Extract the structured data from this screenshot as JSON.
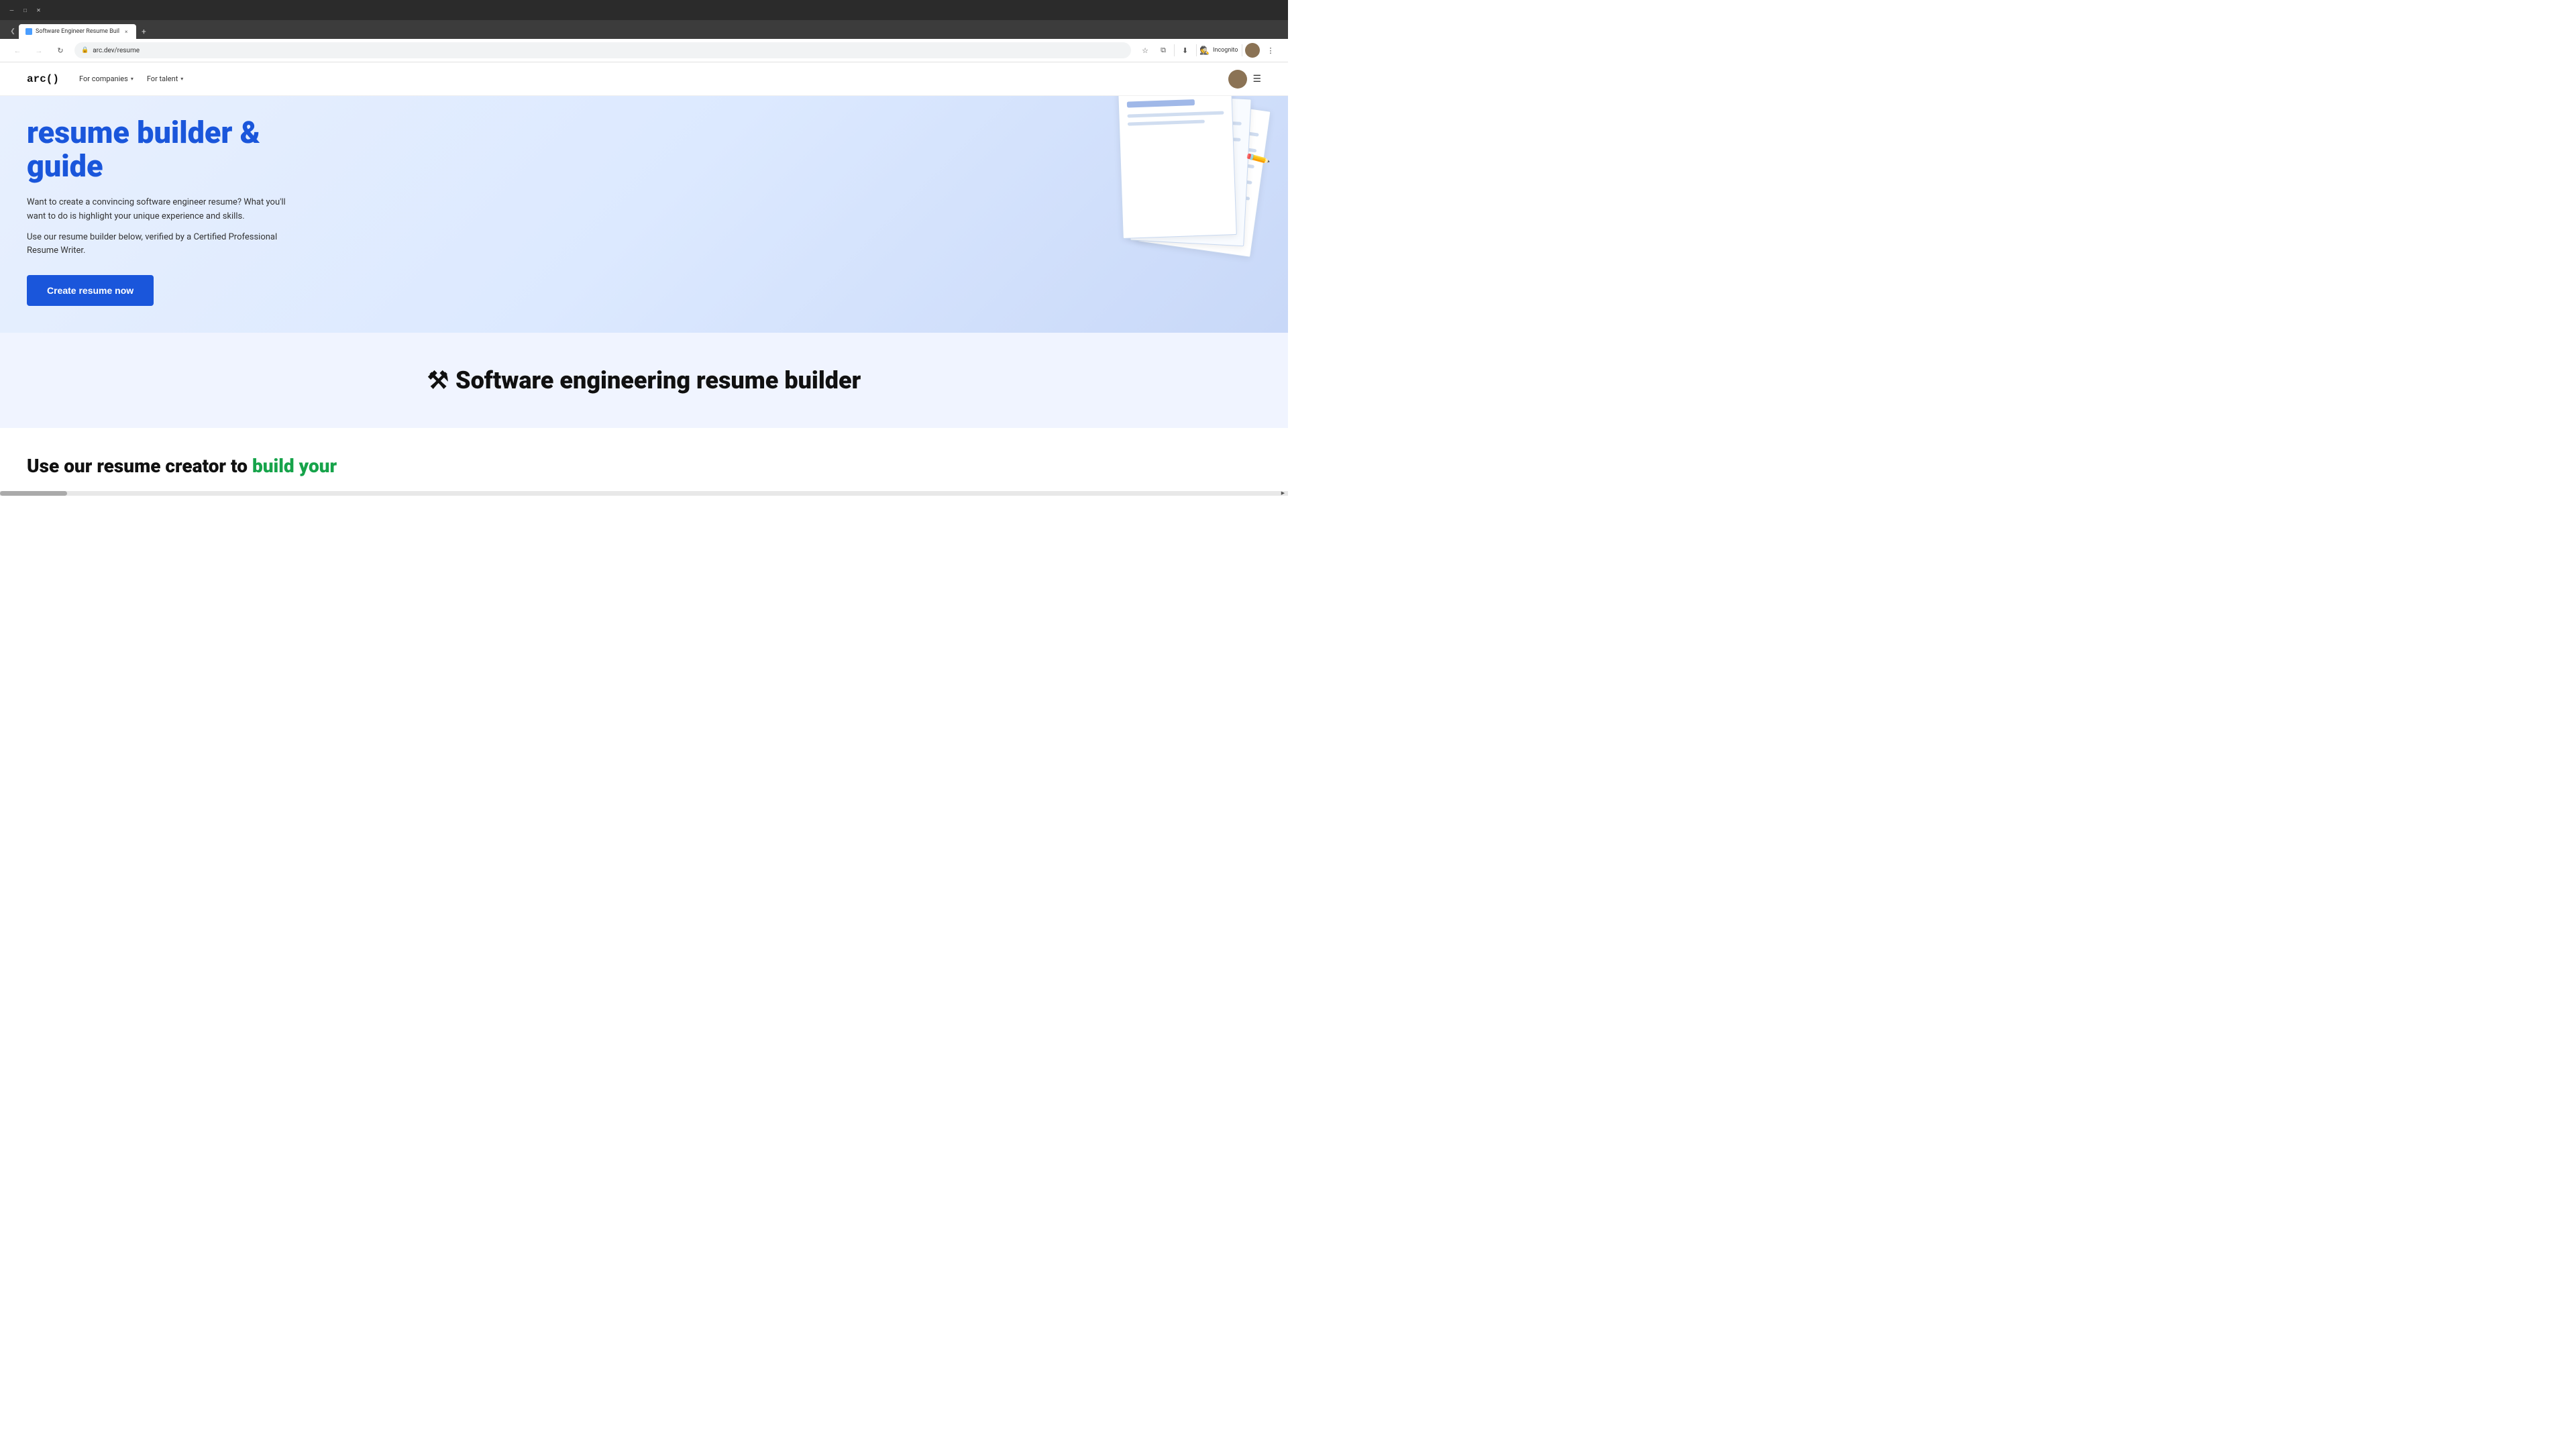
{
  "browser": {
    "tab": {
      "favicon_label": "arc",
      "title": "Software Engineer Resume Buil",
      "close_label": "×"
    },
    "new_tab_label": "+",
    "address": {
      "url": "arc.dev/resume",
      "back_icon": "←",
      "forward_icon": "→",
      "refresh_icon": "↻",
      "star_icon": "☆",
      "extensions_icon": "⧉",
      "download_icon": "⬇",
      "incognito_label": "Incognito",
      "menu_icon": "⋮"
    }
  },
  "site": {
    "logo": "arc()",
    "nav": {
      "companies_label": "For companies",
      "talent_label": "For talent",
      "chevron": "▾"
    },
    "hero": {
      "title": "resume builder & guide",
      "description1": "Want to create a convincing software engineer resume? What you'll want to do is highlight your unique experience and skills.",
      "description2": "Use our resume builder below, verified by a Certified Professional Resume Writer.",
      "cta_label": "Create resume now"
    },
    "section2": {
      "icon": "⚒",
      "title": "Software engineering resume builder"
    },
    "section3": {
      "text_part1": "Use our resume creator to",
      "text_part2": "build your",
      "highlight_color": "#16a34a"
    }
  },
  "colors": {
    "brand_blue": "#1a56db",
    "hero_bg_start": "#e8f0fe",
    "hero_bg_end": "#c8d8f8",
    "section2_bg": "#f0f4ff",
    "green_highlight": "#16a34a",
    "nav_bg": "#ffffff"
  }
}
